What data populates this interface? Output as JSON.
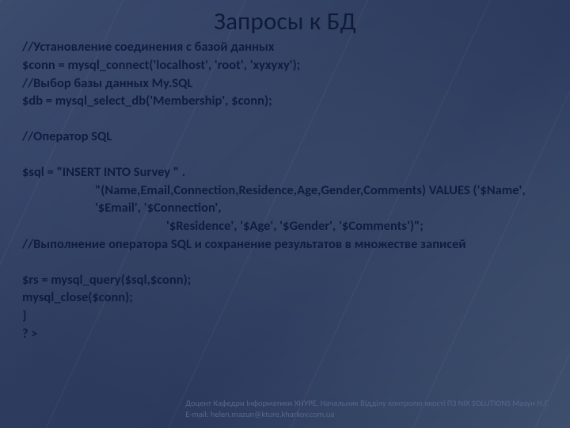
{
  "title": "Запросы к БД",
  "lines": {
    "l1": "//Установление соединения с базой данных",
    "l2": "$conn = mysql_connect('localhost', 'root', 'xyxyxy');",
    "l3": "//Выбор базы данных My.SQL",
    "l4": "$db = mysql_select_db('Membership', $conn);",
    "l5": "//Оператор SQL",
    "l6": "$sql = \"INSERT INTO Survey \" .",
    "l7": "\"(Name,Email,Connection,Residence,Age,Gender,Comments) VALUES ('$Name', '$Email', '$Connection',",
    "l8": "'$Residence', '$Age', '$Gender', '$Comments')\";",
    "l9": "//Выполнение оператора SQL и сохранение результатов в множестве записей",
    "l10": "$rs = mysql_query($sql,$conn);",
    "l11": "mysql_close($conn);",
    "l12": "}",
    "l13": "? >"
  },
  "footer": {
    "line1": "Доцент Кафедри Інформатики ХНУРЕ, Начальник Відділу контролю якості ПЗ NIX SOLUTIONS Мазун Н.Г.",
    "line2": "E-mail:  helen.mazun@kture.kharkov.com.ua"
  }
}
